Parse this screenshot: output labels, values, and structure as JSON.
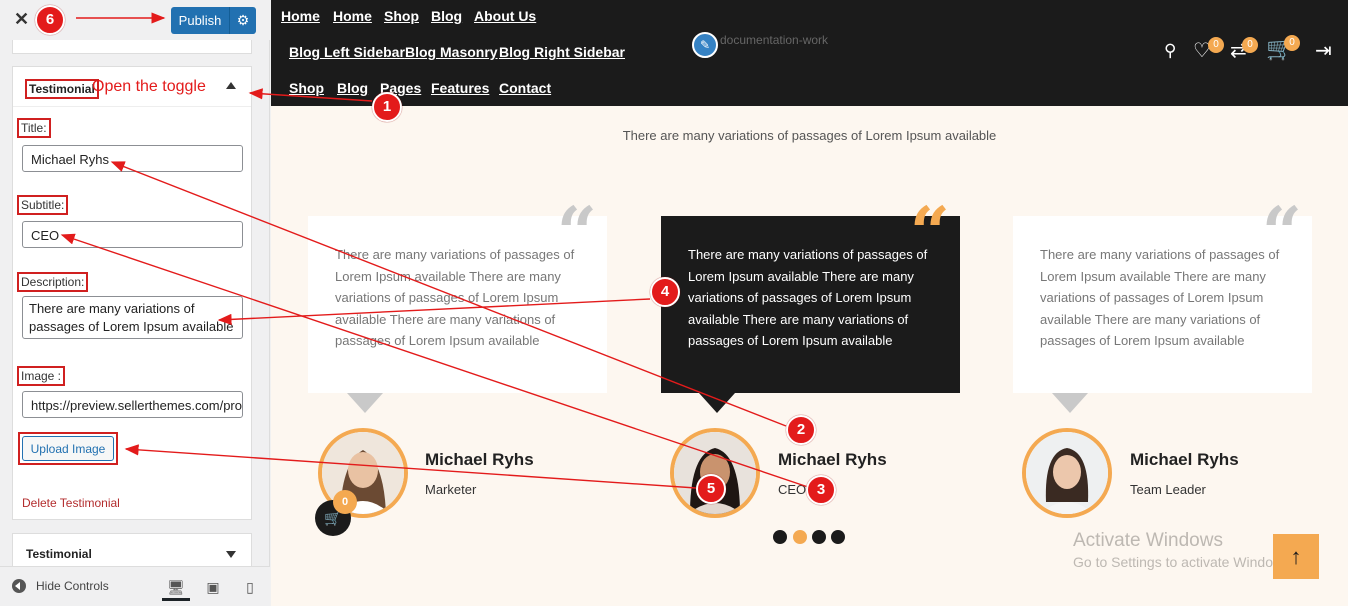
{
  "sidebar": {
    "publish_label": "Publish",
    "panel_title": "Testimonial",
    "toggle_hint": "Open the toggle",
    "fields": {
      "title_label": "Title:",
      "title_value": "Michael Ryhs",
      "subtitle_label": "Subtitle:",
      "subtitle_value": "CEO",
      "description_label": "Description:",
      "description_value": "There are many variations of passages of Lorem Ipsum available",
      "image_label": "Image :",
      "image_value": "https://preview.sellerthemes.com/pro"
    },
    "upload_label": "Upload Image",
    "delete_label": "Delete Testimonial",
    "next_panel_title": "Testimonial",
    "hide_controls_label": "Hide Controls"
  },
  "preview": {
    "nav_row1": [
      "Home",
      "Home",
      "Shop",
      "Blog",
      "About Us"
    ],
    "nav_row2": [
      "Blog Left Sidebar",
      "Blog Masonry",
      "Blog Right Sidebar"
    ],
    "nav_row3": [
      "Shop",
      "Blog",
      "Pages",
      "Features",
      "Contact"
    ],
    "broken_image_alt": "documentation-work",
    "wishlist_count": "0",
    "compare_count": "0",
    "cart_count": "0",
    "intro": "There are many variations of passages of Lorem Ipsum available",
    "testimonials": [
      {
        "text": "There are many variations of passages of Lorem Ipsum available There are many variations of passages of Lorem Ipsum available There are many variations of passages of Lorem Ipsum available",
        "name": "Michael Ryhs",
        "role": "Marketer"
      },
      {
        "text": "There are many variations of passages of Lorem Ipsum available There are many variations of passages of Lorem Ipsum available There are many variations of passages of Lorem Ipsum available",
        "name": "Michael Ryhs",
        "role": "CEO"
      },
      {
        "text": "There are many variations of passages of Lorem Ipsum available There are many variations of passages of Lorem Ipsum available There are many variations of passages of Lorem Ipsum available",
        "name": "Michael Ryhs",
        "role": "Team Leader"
      }
    ],
    "floating_cart_count": "0",
    "watermark_title": "Activate Windows",
    "watermark_sub": "Go to Settings to activate Windows."
  },
  "annotations": [
    "1",
    "2",
    "3",
    "4",
    "5",
    "6"
  ],
  "colors": {
    "accent": "#f4a951",
    "dark": "#1b1b1b",
    "wp_blue": "#2271b1",
    "annotation_red": "#e31b1b"
  }
}
